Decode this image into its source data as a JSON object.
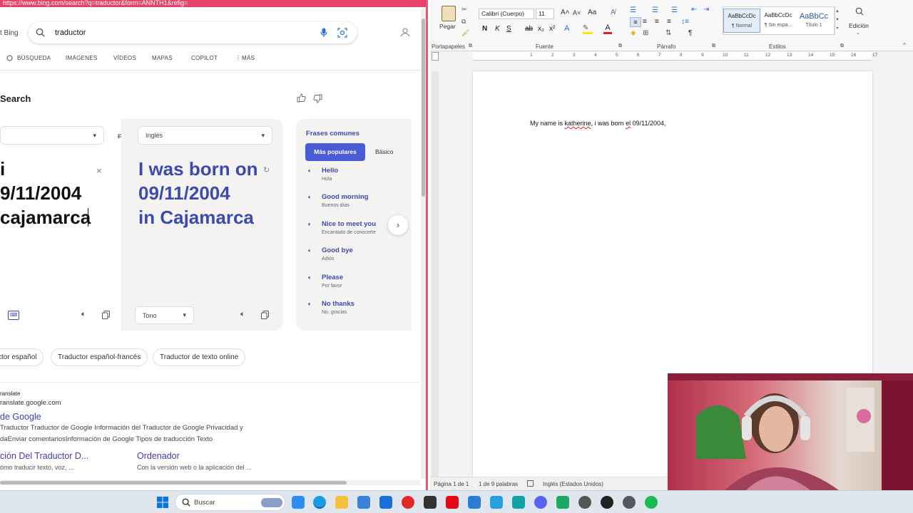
{
  "browser": {
    "address": "https://www.bing.com/search?q=traductor&form=ANNTH1&refig=",
    "brand": "t Bing",
    "search_value": "traductor",
    "nav": [
      "BÚSQUEDA",
      "IMÁGENES",
      "VÍDEOS",
      "MAPAS",
      "COPILOT",
      "MÁS"
    ],
    "section_title": "Search",
    "translator": {
      "src_lang": "",
      "dst_lang": "Inglés",
      "src_lines": [
        "i",
        "9/11/2004",
        "cajamarca"
      ],
      "dst_lines": [
        "I was born on",
        "09/11/2004",
        "in Cajamarca"
      ],
      "tone_label": "Tono"
    },
    "phrases": {
      "title": "Frases comunes",
      "tab_popular": "Más populares",
      "tab_basic": "Básico",
      "items": [
        {
          "en": "Hello",
          "es": "Hola"
        },
        {
          "en": "Good morning",
          "es": "Buenos días"
        },
        {
          "en": "Nice to meet you",
          "es": "Encantado de conocerte"
        },
        {
          "en": "Good bye",
          "es": "Adiós"
        },
        {
          "en": "Please",
          "es": "Por favor"
        },
        {
          "en": "No thanks",
          "es": "No, gracias"
        }
      ]
    },
    "chips": [
      "ctor español",
      "Traductor español-francés",
      "Traductor de texto online"
    ],
    "result": {
      "site": "ranslate",
      "url": "ranslate.google.com",
      "title": "de Google",
      "desc1": "Traductor Traductor de Google Información del Traductor de Google Privacidad y",
      "desc2": "daEnviar comentariosInformación de Google Tipos de traducción Texto",
      "sub1_title": "ción Del Traductor D...",
      "sub1_desc": "ómo traducir texto, voz, ...",
      "sub2_title": "Ordenador",
      "sub2_desc": "Con la versión web o la aplicación del ..."
    }
  },
  "word": {
    "paste_label": "Pegar",
    "clipboard_label": "Portapapeles",
    "font_name": "Calibri (Cuerpo)",
    "font_size": "11",
    "font_group": "Fuente",
    "paragraph_group": "Párrafo",
    "styles_group": "Estilos",
    "editing_label": "Edición",
    "styles": [
      {
        "preview": "AaBbCcDc",
        "name": "¶ Normal"
      },
      {
        "preview": "AaBbCcDc",
        "name": "¶ Sin espa..."
      },
      {
        "preview": "AaBbCc",
        "name": "Título 1"
      }
    ],
    "ruler_marks": [
      "1",
      "2",
      "3",
      "4",
      "5",
      "6",
      "7",
      "8",
      "9",
      "10",
      "11",
      "12",
      "13",
      "14",
      "15",
      "16",
      "17"
    ],
    "doc_text_a": "My name is ",
    "doc_text_b": "katherine",
    "doc_text_c": ", i was born ",
    "doc_text_d": "el",
    "doc_text_e": " 09/11/2004,",
    "status_page": "Página 1 de 1",
    "status_words": "1 de 9 palabras",
    "status_lang": "Inglés (Estados Unidos)"
  },
  "taskbar": {
    "search_placeholder": "Buscar"
  }
}
